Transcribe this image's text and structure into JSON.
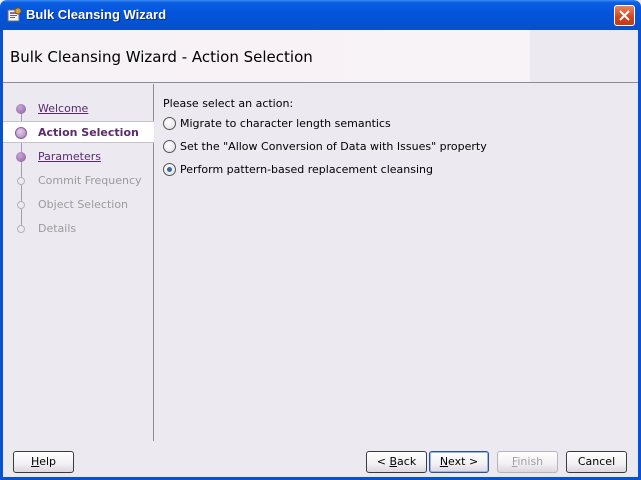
{
  "window": {
    "title": "Bulk Cleansing Wizard",
    "icon": "wizard-app-icon",
    "close_icon": "close-icon"
  },
  "header": {
    "title": "Bulk Cleansing Wizard - Action Selection"
  },
  "nav": {
    "items": [
      {
        "label": "Welcome",
        "state": "link"
      },
      {
        "label": "Action Selection",
        "state": "current"
      },
      {
        "label": "Parameters",
        "state": "link"
      },
      {
        "label": "Commit Frequency",
        "state": "disabled"
      },
      {
        "label": "Object Selection",
        "state": "disabled"
      },
      {
        "label": "Details",
        "state": "disabled"
      }
    ]
  },
  "content": {
    "prompt": "Please select an action:",
    "options": [
      {
        "label": "Migrate to character length semantics",
        "checked": false
      },
      {
        "label": "Set the \"Allow Conversion of Data with Issues\" property",
        "checked": false
      },
      {
        "label": "Perform pattern-based replacement cleansing",
        "checked": true
      }
    ]
  },
  "buttons": {
    "help": {
      "mnemonic": "H",
      "rest": "elp"
    },
    "back": {
      "prefix": "< ",
      "mnemonic": "B",
      "rest": "ack"
    },
    "next": {
      "mnemonic": "N",
      "rest": "ext >"
    },
    "finish": {
      "mnemonic": "F",
      "rest": "inish"
    },
    "cancel": {
      "label": "Cancel"
    }
  },
  "colors": {
    "titlebar": "#0454dc",
    "accent": "#5a2a6e",
    "disabled_text": "#9b9b9b"
  }
}
